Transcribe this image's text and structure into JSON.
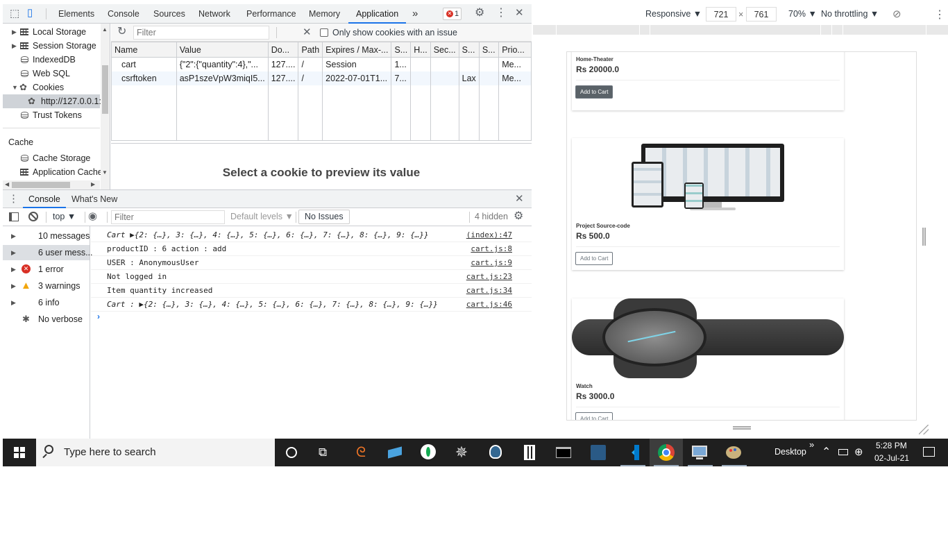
{
  "devtools": {
    "tabs": [
      "Elements",
      "Console",
      "Sources",
      "Network",
      "Performance",
      "Memory",
      "Application"
    ],
    "active_tab": "Application",
    "more_tabs": "»",
    "error_badge": "1",
    "close": "✕"
  },
  "sidebar": {
    "storage_items": [
      {
        "label": "Local Storage"
      },
      {
        "label": "Session Storage"
      },
      {
        "label": "IndexedDB"
      },
      {
        "label": "Web SQL"
      },
      {
        "label": "Cookies"
      },
      {
        "label": "http://127.0.0.1:"
      },
      {
        "label": "Trust Tokens"
      }
    ],
    "cache_header": "Cache",
    "cache_items": [
      {
        "label": "Cache Storage"
      },
      {
        "label": "Application Cache"
      }
    ]
  },
  "cookies": {
    "filter_placeholder": "Filter",
    "issue_checkbox_label": "Only show cookies with an issue",
    "columns": [
      "Name",
      "Value",
      "Do...",
      "Path",
      "Expires / Max-...",
      "S...",
      "H...",
      "Sec...",
      "S...",
      "S...",
      "Prio..."
    ],
    "rows": [
      [
        "cart",
        "{\"2\":{\"quantity\":4},\"...",
        "127....",
        "/",
        "Session",
        "1...",
        "",
        "",
        "",
        "",
        "Me..."
      ],
      [
        "csrftoken",
        "asP1szeVpW3miqI5...",
        "127....",
        "/",
        "2022-07-01T1...",
        "7...",
        "",
        "",
        "Lax",
        "",
        "Me..."
      ]
    ],
    "preview_hint": "Select a cookie to preview its value"
  },
  "drawer": {
    "tabs": [
      "Console",
      "What's New"
    ],
    "context": "top",
    "filter_placeholder": "Filter",
    "levels": "Default levels",
    "issues": "No Issues",
    "hidden": "4 hidden"
  },
  "console_sidebar": [
    {
      "label": "10 messages"
    },
    {
      "label": "6 user mess..."
    },
    {
      "label": "1 error"
    },
    {
      "label": "3 warnings"
    },
    {
      "label": "6 info"
    },
    {
      "label": "No verbose"
    }
  ],
  "console_log": [
    {
      "msg": "Cart ▶{2: {…}, 3: {…}, 4: {…}, 5: {…}, 6: {…}, 7: {…}, 8: {…}, 9: {…}}",
      "src": "(index):47"
    },
    {
      "msg": "productID : 6 action : add",
      "src": "cart.js:8"
    },
    {
      "msg": "USER : AnonymousUser",
      "src": "cart.js:9"
    },
    {
      "msg": "Not logged in",
      "src": "cart.js:23"
    },
    {
      "msg": "Item quantity increased",
      "src": "cart.js:34"
    },
    {
      "msg": "Cart : ▶{2: {…}, 3: {…}, 4: {…}, 5: {…}, 6: {…}, 7: {…}, 8: {…}, 9: {…}}",
      "src": "cart.js:46"
    }
  ],
  "device": {
    "mode": "Responsive ▼",
    "width": "721",
    "times": "×",
    "height": "761",
    "zoom": "70% ▼",
    "throttle": "No throttling ▼"
  },
  "products": [
    {
      "name": "Home-Theater",
      "price": "Rs 20000.0",
      "button": "Add to Cart"
    },
    {
      "name": "Project Source-code",
      "price": "Rs 500.0",
      "button": "Add to Cart"
    },
    {
      "name": "Watch",
      "price": "Rs 3000.0",
      "button": "Add to Cart"
    }
  ],
  "taskbar": {
    "search_placeholder": "Type here to search",
    "desktop": "Desktop",
    "time": "5:28 PM",
    "date": "02-Jul-21"
  },
  "colors": {
    "accent": "#1a73e8",
    "error": "#d93025",
    "warning": "#f2a60c",
    "taskbar": "#1f1f1f"
  }
}
